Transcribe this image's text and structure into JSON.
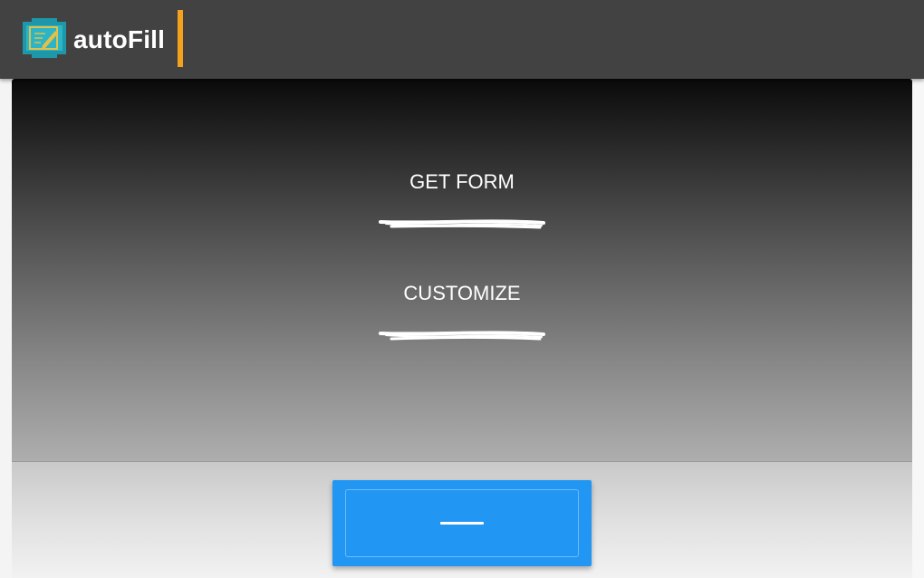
{
  "app": {
    "title": "autoFill",
    "accent_color": "#f4a21e",
    "logo_icon": "form-pen-icon"
  },
  "menu": {
    "items": [
      {
        "label": "GET FORM"
      },
      {
        "label": "CUSTOMIZE"
      }
    ]
  },
  "action_button": {
    "color": "#2196f3",
    "icon": "minus-icon"
  }
}
